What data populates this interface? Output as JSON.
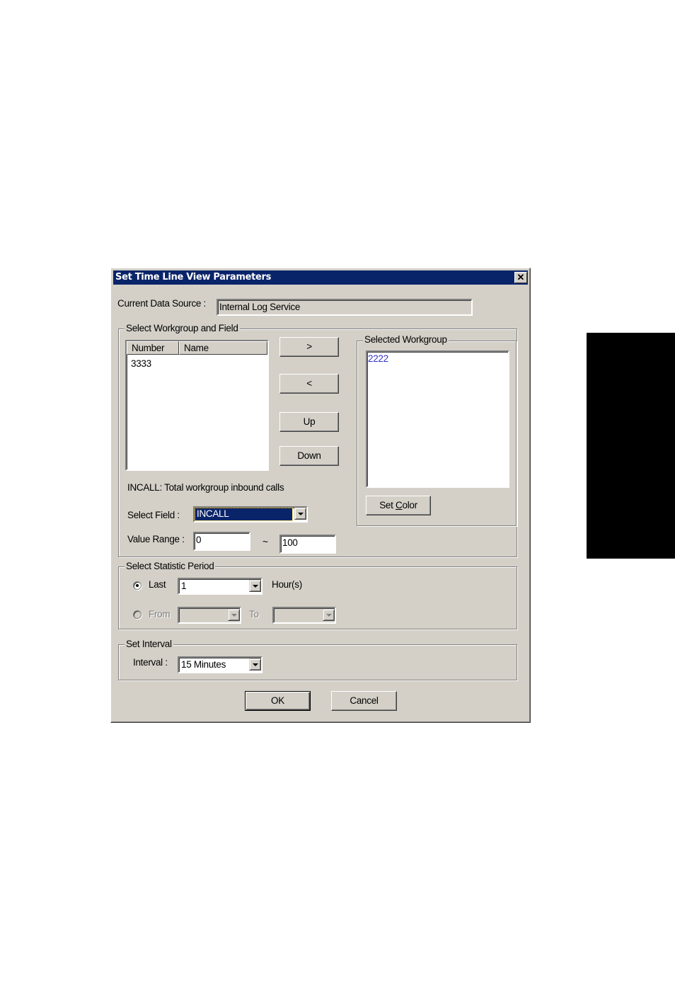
{
  "dialog": {
    "title": "Set Time Line View Parameters",
    "close_icon": "close-icon"
  },
  "data_source": {
    "label": "Current Data Source :",
    "value": "Internal Log Service"
  },
  "workgroup_field": {
    "group_label": "Select Workgroup and Field",
    "list_columns": [
      "Number",
      "Name"
    ],
    "list_items": [
      {
        "number": "3333",
        "name": ""
      }
    ],
    "buttons": {
      "add": ">",
      "remove": "<",
      "up": "Up",
      "down": "Down"
    },
    "field_description": "INCALL: Total workgroup inbound calls",
    "select_field_label": "Select Field :",
    "select_field_value": "INCALL",
    "value_range_label": "Value Range :",
    "value_range_min": "0",
    "value_range_sep": "~",
    "value_range_max": "100"
  },
  "selected_workgroup": {
    "group_label": "Selected Workgroup",
    "items": [
      "2222"
    ],
    "item_color": "#3333cc",
    "set_color_label": "Set Color"
  },
  "statistic_period": {
    "group_label": "Select Statistic Period",
    "last_label": "Last",
    "last_value": "1",
    "last_unit": "Hour(s)",
    "last_checked": true,
    "from_label": "From",
    "from_value": "",
    "to_label": "To",
    "to_value": ""
  },
  "interval": {
    "group_label": "Set Interval",
    "label": "Interval :",
    "value": "15 Minutes"
  },
  "footer": {
    "ok_label": "OK",
    "cancel_label": "Cancel"
  },
  "colors": {
    "titlebar": "#0a246a",
    "dialog_bg": "#d4d0c8",
    "selection": "#0a246a",
    "side_tab": "#000000"
  }
}
